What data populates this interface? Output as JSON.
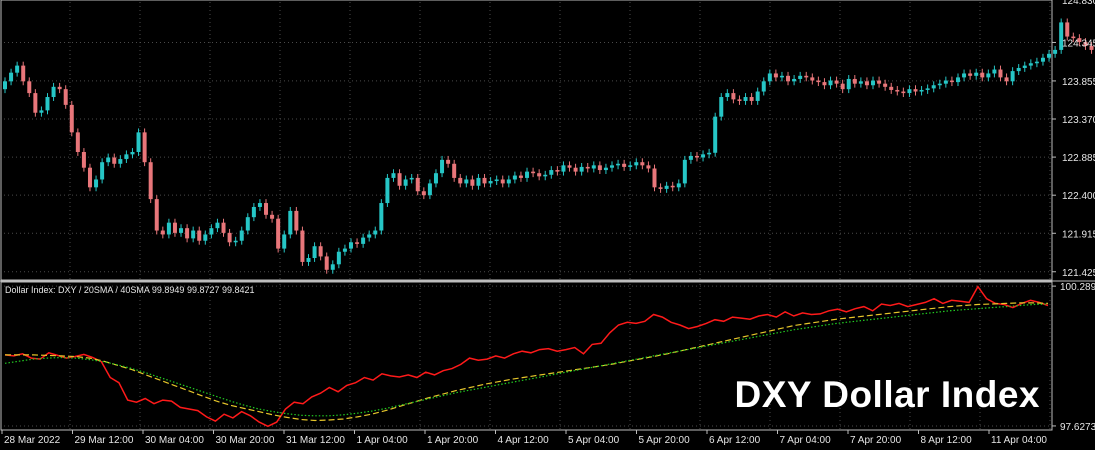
{
  "chart_data": [
    {
      "type": "candlestick",
      "title": "",
      "x_ticks": [
        "28 Mar 2022",
        "29 Mar 12:00",
        "30 Mar 04:00",
        "30 Mar 20:00",
        "31 Mar 12:00",
        "1 Apr 04:00",
        "1 Apr 20:00",
        "4 Apr 12:00",
        "5 Apr 04:00",
        "5 Apr 20:00",
        "6 Apr 12:00",
        "7 Apr 04:00",
        "7 Apr 20:00",
        "8 Apr 12:00",
        "11 Apr 04:00"
      ],
      "y_ticks": [
        "124.345",
        "123.855",
        "123.370",
        "122.885",
        "122.400",
        "121.915",
        "121.425"
      ],
      "y_top_partial": "124.830",
      "ylim": [
        121.32,
        124.86
      ],
      "grid": true,
      "colors": {
        "up": "#26c6c6",
        "down": "#e8767a",
        "grid": "#4a4a4a",
        "background": "#000000"
      },
      "close": [
        123.85,
        123.96,
        124.05,
        123.85,
        123.7,
        123.45,
        123.48,
        123.65,
        123.78,
        123.75,
        123.55,
        123.2,
        122.95,
        122.75,
        122.5,
        122.6,
        122.82,
        122.88,
        122.8,
        122.86,
        122.92,
        122.95,
        123.2,
        122.82,
        122.35,
        121.95,
        121.9,
        122.05,
        121.92,
        121.98,
        121.85,
        121.95,
        121.82,
        121.9,
        121.98,
        122.05,
        121.92,
        121.8,
        121.82,
        121.95,
        122.12,
        122.25,
        122.3,
        122.15,
        122.1,
        121.72,
        121.9,
        122.2,
        121.95,
        121.55,
        121.6,
        121.75,
        121.62,
        121.45,
        121.52,
        121.68,
        121.72,
        121.8,
        121.78,
        121.86,
        121.9,
        121.95,
        122.3,
        122.62,
        122.68,
        122.52,
        122.6,
        122.62,
        122.45,
        122.4,
        122.55,
        122.68,
        122.85,
        122.8,
        122.62,
        122.55,
        122.6,
        122.52,
        122.62,
        122.55,
        122.58,
        122.6,
        122.55,
        122.6,
        122.65,
        122.62,
        122.7,
        122.68,
        122.64,
        122.66,
        122.72,
        122.7,
        122.78,
        122.75,
        122.7,
        122.76,
        122.74,
        122.78,
        122.72,
        122.75,
        122.78,
        122.8,
        122.76,
        122.78,
        122.82,
        122.78,
        122.74,
        122.5,
        122.48,
        122.52,
        122.5,
        122.55,
        122.85,
        122.9,
        122.88,
        122.92,
        122.94,
        123.4,
        123.65,
        123.7,
        123.62,
        123.6,
        123.65,
        123.6,
        123.72,
        123.85,
        123.95,
        123.9,
        123.92,
        123.85,
        123.88,
        123.92,
        123.9,
        123.86,
        123.84,
        123.8,
        123.86,
        123.82,
        123.75,
        123.88,
        123.82,
        123.85,
        123.8,
        123.86,
        123.82,
        123.78,
        123.74,
        123.72,
        123.7,
        123.75,
        123.72,
        123.74,
        123.76,
        123.8,
        123.82,
        123.86,
        123.84,
        123.9,
        123.95,
        123.92,
        123.96,
        123.9,
        123.95,
        124.0,
        123.9,
        123.85,
        123.98,
        124.02,
        124.05,
        124.08,
        124.1,
        124.15,
        124.2,
        124.25,
        124.6,
        124.42,
        124.4,
        124.35,
        124.3,
        124.25,
        124.45,
        124.62,
        124.72
      ]
    },
    {
      "type": "line",
      "title": "Dollar Index: DXY / 20SMA / 40SMA 99.8949 99.8727 99.8421",
      "y_ticks": [
        "100.2897",
        "97.6273"
      ],
      "ylim": [
        97.55,
        100.33
      ],
      "x": "shared with candlestick x_ticks",
      "series": [
        {
          "name": "DXY",
          "color": "#ff1a1a",
          "style": "solid",
          "values": [
            98.98,
            98.96,
            99.0,
            98.92,
            98.9,
            99.02,
            98.97,
            98.92,
            98.95,
            98.99,
            98.93,
            98.85,
            98.55,
            98.45,
            98.12,
            98.08,
            98.15,
            98.05,
            98.12,
            98.1,
            97.98,
            97.95,
            97.92,
            97.8,
            97.72,
            97.85,
            97.78,
            97.9,
            97.82,
            97.7,
            97.62,
            97.7,
            97.95,
            98.08,
            98.05,
            98.18,
            98.25,
            98.36,
            98.28,
            98.4,
            98.45,
            98.55,
            98.5,
            98.62,
            98.58,
            98.56,
            98.6,
            98.55,
            98.65,
            98.6,
            98.68,
            98.72,
            98.8,
            98.92,
            98.88,
            98.9,
            98.96,
            98.92,
            99.0,
            99.05,
            99.02,
            99.08,
            99.1,
            99.05,
            99.08,
            99.12,
            99.0,
            99.18,
            99.2,
            99.4,
            99.55,
            99.6,
            99.58,
            99.62,
            99.75,
            99.7,
            99.6,
            99.55,
            99.48,
            99.52,
            99.58,
            99.65,
            99.62,
            99.7,
            99.68,
            99.66,
            99.72,
            99.75,
            99.7,
            99.8,
            99.72,
            99.78,
            99.75,
            99.76,
            99.82,
            99.85,
            99.8,
            99.86,
            99.9,
            99.82,
            99.95,
            99.92,
            99.96,
            99.9,
            99.94,
            99.98,
            100.05,
            99.96,
            100.02,
            100.0,
            99.98,
            100.28,
            100.05,
            99.96,
            99.94,
            99.88,
            99.96,
            100.02,
            99.98,
            99.92
          ]
        },
        {
          "name": "20SMA",
          "color": "#e6c62a",
          "style": "dashed",
          "values": [
            98.98,
            98.98,
            98.98,
            98.97,
            98.96,
            98.95,
            98.92,
            98.86,
            98.78,
            98.7,
            98.6,
            98.5,
            98.4,
            98.3,
            98.2,
            98.1,
            98.02,
            97.96,
            97.9,
            97.84,
            97.79,
            97.75,
            97.73,
            97.74,
            97.76,
            97.8,
            97.85,
            97.92,
            98.0,
            98.08,
            98.16,
            98.23,
            98.3,
            98.36,
            98.42,
            98.47,
            98.52,
            98.56,
            98.6,
            98.64,
            98.68,
            98.72,
            98.76,
            98.8,
            98.85,
            98.9,
            98.95,
            99.0,
            99.06,
            99.12,
            99.18,
            99.24,
            99.3,
            99.36,
            99.42,
            99.48,
            99.54,
            99.58,
            99.62,
            99.66,
            99.69,
            99.72,
            99.75,
            99.78,
            99.81,
            99.84,
            99.87,
            99.9,
            99.92,
            99.94,
            99.95,
            99.96,
            99.97,
            99.97,
            99.96
          ]
        },
        {
          "name": "40SMA",
          "color": "#22cc22",
          "style": "dotted",
          "values": [
            98.82,
            98.86,
            98.9,
            98.92,
            98.93,
            98.92,
            98.89,
            98.85,
            98.79,
            98.72,
            98.64,
            98.55,
            98.46,
            98.37,
            98.28,
            98.19,
            98.1,
            98.02,
            97.95,
            97.9,
            97.86,
            97.83,
            97.82,
            97.82,
            97.84,
            97.87,
            97.91,
            97.96,
            98.02,
            98.08,
            98.14,
            98.2,
            98.26,
            98.31,
            98.36,
            98.41,
            98.46,
            98.51,
            98.56,
            98.61,
            98.66,
            98.71,
            98.76,
            98.81,
            98.86,
            98.91,
            98.96,
            99.01,
            99.06,
            99.11,
            99.16,
            99.21,
            99.26,
            99.31,
            99.36,
            99.41,
            99.46,
            99.5,
            99.54,
            99.58,
            99.61,
            99.64,
            99.67,
            99.7,
            99.73,
            99.76,
            99.79,
            99.82,
            99.84,
            99.86,
            99.88,
            99.9,
            99.92,
            99.94,
            99.95
          ]
        }
      ]
    }
  ],
  "indicator_label": "Dollar Index: DXY / 20SMA / 40SMA 99.8949 99.8727 99.8421",
  "watermark": "DXY Dollar Index"
}
